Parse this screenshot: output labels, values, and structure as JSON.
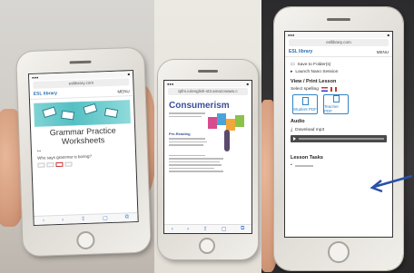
{
  "photo": {
    "description_colors": {
      "accent_blue": "#2f84c8",
      "teal": "#54c0c3",
      "title_blue": "#3a4f9a"
    }
  },
  "left_phone": {
    "url": "esllibrary.com",
    "brand": "ESL library",
    "menu_label": "MENU",
    "lesson_title": "Grammar Practice Worksheets",
    "question": "Who says grammar is boring?"
  },
  "middle_phone": {
    "url": "tpfrs.io/english-st3.amazonaws.c",
    "title": "Consumerism",
    "section": "Pre-Reading"
  },
  "right_phone": {
    "url": "esllibrary.com",
    "brand": "ESL library",
    "menu_label": "MENU",
    "save_label": "Save to Folder(s)",
    "launch_label": "Launch Nano Session",
    "view_print_heading": "View / Print Lesson",
    "select_spelling_label": "Select spelling",
    "student_pdf_label": "Student PDF",
    "teacher_pdf_label": "Teacher PDF",
    "audio_heading": "Audio",
    "download_label": "Download mp3",
    "lesson_tasks_heading": "Lesson Tasks"
  }
}
